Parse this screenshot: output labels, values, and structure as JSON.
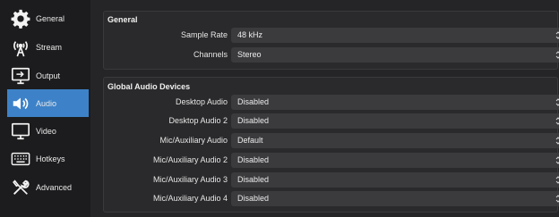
{
  "sidebar": {
    "items": [
      {
        "label": "General",
        "icon": "gear-icon"
      },
      {
        "label": "Stream",
        "icon": "broadcast-tower-icon"
      },
      {
        "label": "Output",
        "icon": "output-screen-icon"
      },
      {
        "label": "Audio",
        "icon": "speaker-icon"
      },
      {
        "label": "Video",
        "icon": "monitor-icon"
      },
      {
        "label": "Hotkeys",
        "icon": "keyboard-icon"
      },
      {
        "label": "Advanced",
        "icon": "wrench-screwdriver-icon"
      }
    ],
    "active": "Audio"
  },
  "general": {
    "title": "General",
    "rows": [
      {
        "label": "Sample Rate",
        "value": "48 kHz"
      },
      {
        "label": "Channels",
        "value": "Stereo"
      }
    ]
  },
  "global_audio": {
    "title": "Global Audio Devices",
    "rows": [
      {
        "label": "Desktop Audio",
        "value": "Disabled"
      },
      {
        "label": "Desktop Audio 2",
        "value": "Disabled"
      },
      {
        "label": "Mic/Auxiliary Audio",
        "value": "Default"
      },
      {
        "label": "Mic/Auxiliary Audio 2",
        "value": "Disabled"
      },
      {
        "label": "Mic/Auxiliary Audio 3",
        "value": "Disabled"
      },
      {
        "label": "Mic/Auxiliary Audio 4",
        "value": "Disabled"
      }
    ]
  },
  "colors": {
    "accent": "#3d82c8",
    "sidebar_bg": "#1c1c1e",
    "panel_bg": "#2a2a2c",
    "select_bg": "#3b3b3e"
  }
}
